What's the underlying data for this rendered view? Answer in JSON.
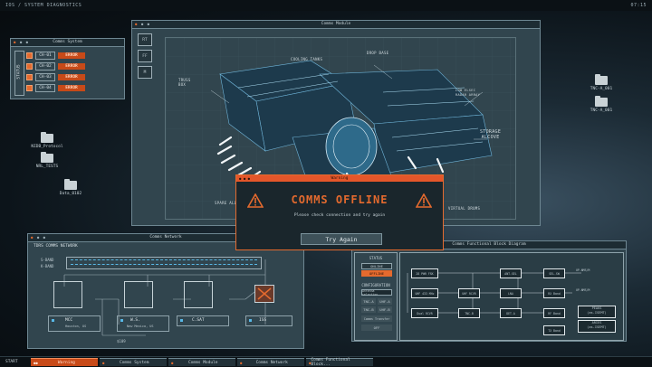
{
  "topbar": {
    "title": "IOS / SYSTEM DIAGNOSTICS",
    "time": "07:15"
  },
  "desktop_icons": [
    {
      "label": "TNC-A_001"
    },
    {
      "label": "TNC-A_001"
    },
    {
      "label": "NIDB_Protocol"
    },
    {
      "label": "NRL_TESTS"
    },
    {
      "label": "Data_0102"
    }
  ],
  "comms_system": {
    "title": "Comms System",
    "status_label": "STATUS",
    "channels": [
      {
        "id": "CH-01",
        "state": "ERROR"
      },
      {
        "id": "CH-02",
        "state": "ERROR"
      },
      {
        "id": "CH-03",
        "state": "ERROR"
      },
      {
        "id": "CH-04",
        "state": "ERROR"
      }
    ]
  },
  "comms_module": {
    "title": "Comms Module",
    "side_buttons": [
      "RT",
      "FF",
      "M"
    ],
    "labels": {
      "truss": "TRUSS\nBOX",
      "cooling": "COOLING TANKS",
      "drop": "DROP BASE",
      "radar": "LOW ELSEC\nRADAR ARRAY",
      "storage": "STORAGE\nALCOVE",
      "spare": "SPARE ALL",
      "virtual": "VIRTUAL DRUMS"
    }
  },
  "warning": {
    "window_title": "Warning",
    "title": "COMMS OFFLINE",
    "message": "Please check connection and try again",
    "button": "Try Again"
  },
  "comms_network": {
    "title": "Comms Network",
    "heading": "TDRS COMMS NETWORK",
    "bands": [
      "S-BAND",
      "K-BAND"
    ],
    "nodes": [
      {
        "name": "MCC",
        "sub": "Houston, US"
      },
      {
        "name": "W.S.",
        "sub": "New Mexico, US"
      },
      {
        "name": "C.SAT",
        "sub": ""
      },
      {
        "name": "ISS",
        "sub": ""
      }
    ],
    "bus_label": "$109"
  },
  "functional": {
    "title": "Comms Functional Block Diagram",
    "status_heading": "STATUS",
    "online": "ONLINE",
    "offline": "OFFLINE",
    "config_heading": "CONFIGURATION",
    "config_item": "Antenna selection",
    "pairs": [
      [
        "TNC-A",
        "UHF-A"
      ],
      [
        "TNC-B",
        "UHF-B"
      ]
    ],
    "transfer": "Comms Transfer",
    "off": "OFF",
    "blocks": [
      "28 PWR FSK",
      "UHF 433 MHz",
      "Dual RCVR",
      "UHF RCVR",
      "TNC-B",
      "ANT-SEL",
      "LNA",
      "DET-A",
      "SEL-SW",
      "RX Band",
      "RF Band",
      "TX Band"
    ],
    "outputs": [
      "UP-NMS/M",
      "UP-NMS/M",
      "PEAKS\n(as-ISEMT)",
      "ARIES\n(as-ISEMT)"
    ]
  },
  "taskbar": {
    "start": "START",
    "tasks": [
      "Warning",
      "Comms System",
      "Comms Module",
      "Comms Network",
      "Comms Functional Block..."
    ]
  },
  "colors": {
    "accent": "#e46a2e",
    "panel": "#31454e",
    "error": "#c84a18"
  }
}
